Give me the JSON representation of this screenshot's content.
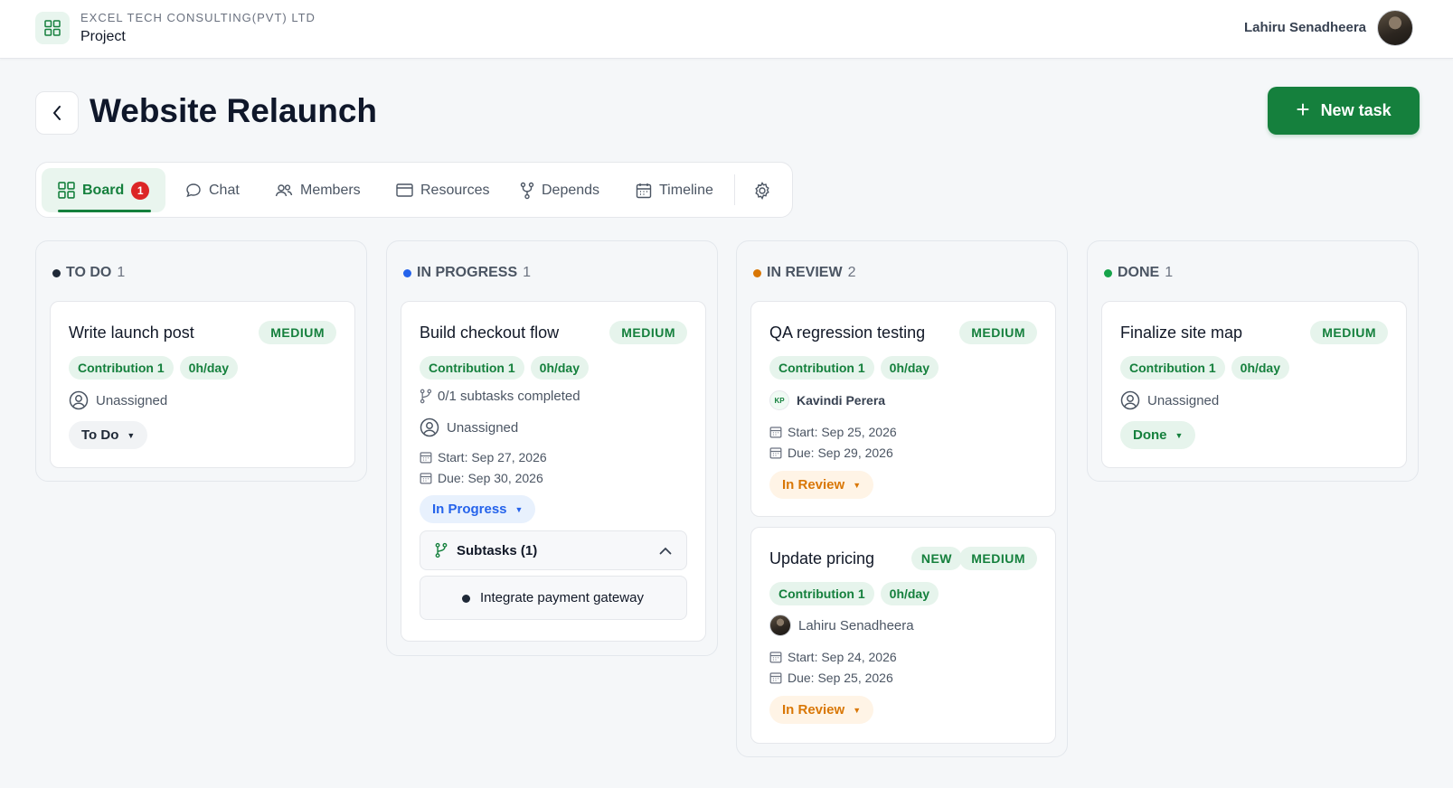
{
  "header": {
    "company": "EXCEL TECH CONSULTING(PVT) LTD",
    "section": "Project",
    "user_name": "Lahiru Senadheera"
  },
  "page": {
    "title": "Website Relaunch",
    "new_task_label": "New task"
  },
  "tabs": [
    {
      "label": "Board",
      "badge": "1",
      "active": true
    },
    {
      "label": "Chat"
    },
    {
      "label": "Members"
    },
    {
      "label": "Resources"
    },
    {
      "label": "Depends"
    },
    {
      "label": "Timeline"
    }
  ],
  "colors": {
    "brand": "#15803d",
    "todo": "#1f2937",
    "in_progress": "#2563eb",
    "in_review": "#d97706",
    "done": "#16a34a"
  },
  "columns": [
    {
      "title": "TO DO",
      "count": "1",
      "cards": [
        {
          "title": "Write launch post",
          "priority": "MEDIUM",
          "contribution": "Contribution 1",
          "rate": "0h/day",
          "assignee": "Unassigned",
          "status": "To Do"
        }
      ]
    },
    {
      "title": "IN PROGRESS",
      "count": "1",
      "cards": [
        {
          "title": "Build checkout flow",
          "priority": "MEDIUM",
          "contribution": "Contribution 1",
          "rate": "0h/day",
          "subtasks_completed": "0/1 subtasks completed",
          "assignee": "Unassigned",
          "start": "Start: Sep 27, 2026",
          "due": "Due: Sep 30, 2026",
          "status": "In Progress",
          "subtasks_label": "Subtasks (1)",
          "subtasks": [
            "Integrate payment gateway"
          ]
        }
      ]
    },
    {
      "title": "IN REVIEW",
      "count": "2",
      "cards": [
        {
          "title": "QA regression testing",
          "priority": "MEDIUM",
          "contribution": "Contribution 1",
          "rate": "0h/day",
          "assignee_initials": "KP",
          "assignee": "Kavindi Perera",
          "start": "Start: Sep 25, 2026",
          "due": "Due: Sep 29, 2026",
          "status": "In Review"
        },
        {
          "title": "Update pricing",
          "new_badge": "NEW",
          "priority": "MEDIUM",
          "contribution": "Contribution 1",
          "rate": "0h/day",
          "assignee": "Lahiru Senadheera",
          "start": "Start: Sep 24, 2026",
          "due": "Due: Sep 25, 2026",
          "status": "In Review"
        }
      ]
    },
    {
      "title": "DONE",
      "count": "1",
      "cards": [
        {
          "title": "Finalize site map",
          "priority": "MEDIUM",
          "contribution": "Contribution 1",
          "rate": "0h/day",
          "assignee": "Unassigned",
          "status": "Done"
        }
      ]
    }
  ]
}
